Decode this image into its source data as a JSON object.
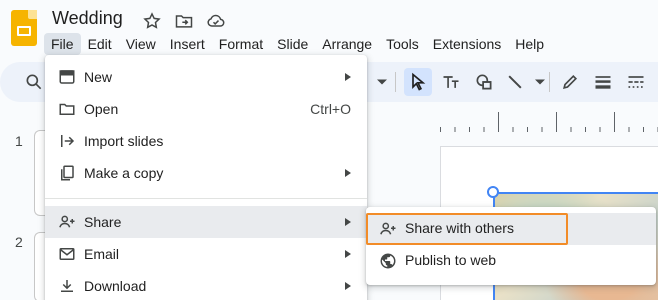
{
  "app": {
    "doc_title": "Wedding",
    "title_icons": [
      "star-icon",
      "move-to-folder-icon",
      "cloud-saved-icon"
    ]
  },
  "menubar": {
    "items": [
      "File",
      "Edit",
      "View",
      "Insert",
      "Format",
      "Slide",
      "Arrange",
      "Tools",
      "Extensions",
      "Help"
    ],
    "active": "File"
  },
  "slides": {
    "numbers": [
      "1",
      "2"
    ]
  },
  "file_menu": {
    "items": [
      {
        "label": "New",
        "icon": "slides-icon",
        "submenu": true
      },
      {
        "label": "Open",
        "icon": "folder-icon",
        "shortcut": "Ctrl+O"
      },
      {
        "label": "Import slides",
        "icon": "import-icon"
      },
      {
        "label": "Make a copy",
        "icon": "copy-icon",
        "submenu": true
      },
      {
        "label": "Share",
        "icon": "person-add-icon",
        "submenu": true,
        "highlighted": true
      },
      {
        "label": "Email",
        "icon": "email-icon",
        "submenu": true
      },
      {
        "label": "Download",
        "icon": "download-icon",
        "submenu": true
      }
    ]
  },
  "share_submenu": {
    "items": [
      {
        "label": "Share with others",
        "icon": "person-add-icon",
        "highlighted": true
      },
      {
        "label": "Publish to web",
        "icon": "globe-icon"
      }
    ]
  },
  "colors": {
    "accent_highlight": "#f28c28",
    "selection_blue": "#4285f4",
    "slides_brand": "#f6b400",
    "toolbar_bg": "#edf2fa"
  }
}
